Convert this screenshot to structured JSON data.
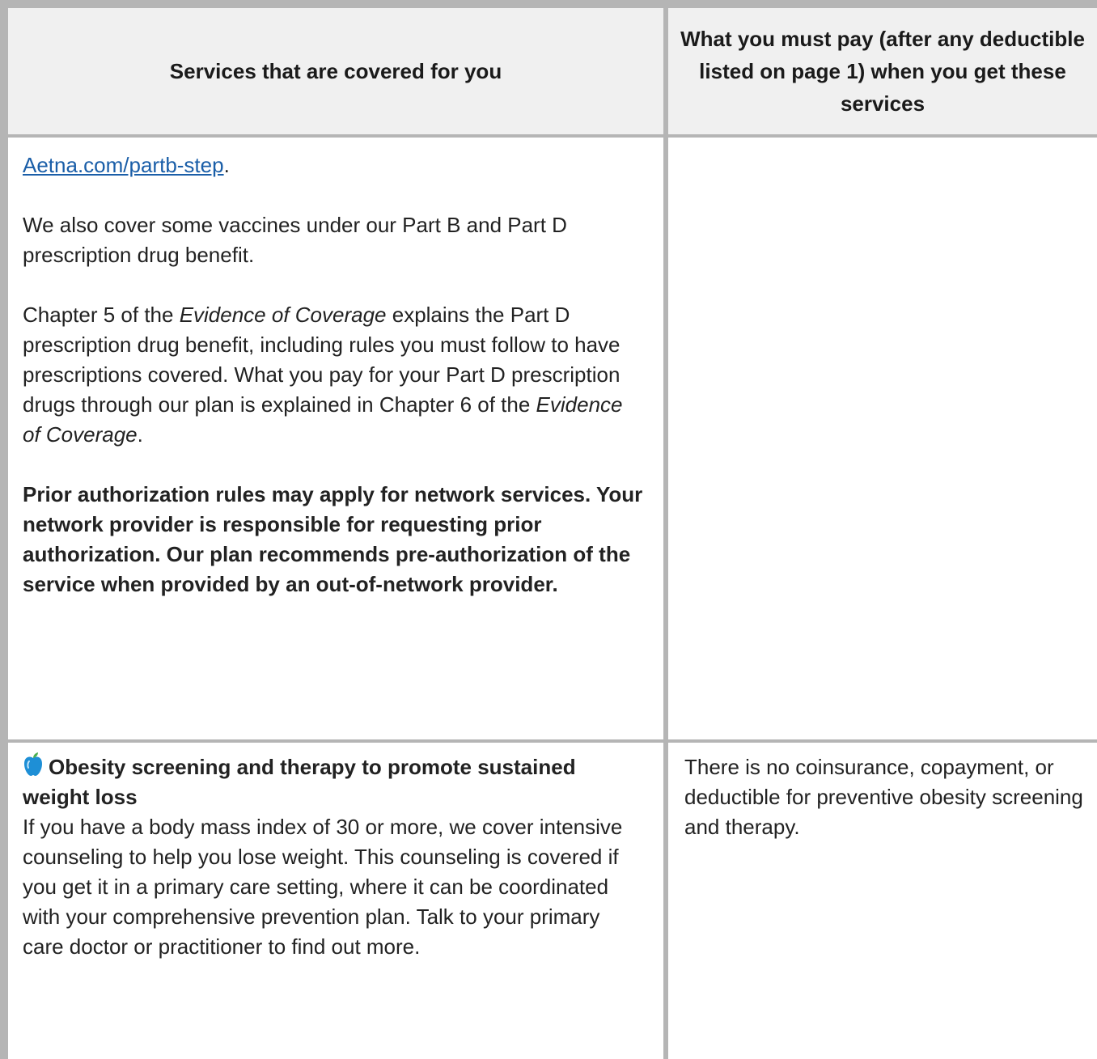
{
  "header": {
    "col1": "Services that are covered for you",
    "col2": "What you must pay (after any deductible listed on page 1) when you get these services"
  },
  "row1": {
    "link_text": "Aetna.com/partb-step",
    "link_suffix": ".",
    "para1": "We also cover some vaccines under our Part B and Part D prescription drug benefit.",
    "para2_a": "Chapter 5 of the ",
    "para2_em1": "Evidence of Coverage",
    "para2_b": " explains the Part D prescription drug benefit, including rules you must follow to have prescriptions covered. What you pay for your Part D prescription drugs through our plan is explained in Chapter 6 of the ",
    "para2_em2": "Evidence of Coverage",
    "para2_c": ".",
    "bold_para": "Prior authorization rules may apply for network services. Your network provider is responsible for requesting prior authorization. Our plan recommends pre-authorization of the service when provided by an out-of-network provider."
  },
  "row2": {
    "icon": "apple-icon",
    "title": "Obesity screening and therapy to promote sustained weight loss",
    "body": "If you have a body mass index of 30 or more, we cover intensive counseling to help you lose weight. This counseling is covered if you get it in a primary care setting, where it can be coordinated with your comprehensive prevention plan. Talk to your primary care doctor or practitioner to find out more.",
    "cost": "There is no coinsurance, copayment, or deductible for preventive obesity screening and therapy."
  },
  "colors": {
    "border": "#b5b5b5",
    "header_bg": "#f0f0f0",
    "link": "#1a5ea8",
    "apple": "#1e8fd6"
  }
}
